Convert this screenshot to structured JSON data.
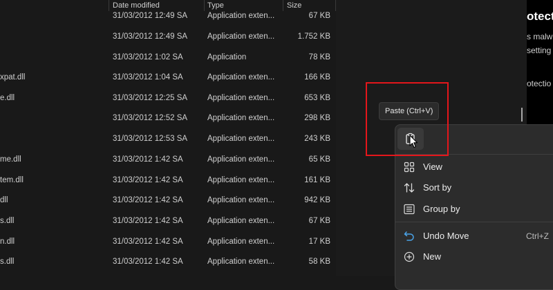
{
  "columns": {
    "date": "Date modified",
    "type": "Type",
    "size": "Size"
  },
  "files": [
    {
      "name": "",
      "date": "31/03/2012 12:49 SA",
      "type": "Application exten...",
      "size": "67 KB"
    },
    {
      "name": "",
      "date": "31/03/2012 12:49 SA",
      "type": "Application exten...",
      "size": "1.752 KB"
    },
    {
      "name": "",
      "date": "31/03/2012 1:02 SA",
      "type": "Application",
      "size": "78 KB"
    },
    {
      "name": "xpat.dll",
      "date": "31/03/2012 1:04 SA",
      "type": "Application exten...",
      "size": "166 KB"
    },
    {
      "name": "e.dll",
      "date": "31/03/2012 12:25 SA",
      "type": "Application exten...",
      "size": "653 KB"
    },
    {
      "name": "",
      "date": "31/03/2012 12:52 SA",
      "type": "Application exten...",
      "size": "298 KB"
    },
    {
      "name": "",
      "date": "31/03/2012 12:53 SA",
      "type": "Application exten...",
      "size": "243 KB"
    },
    {
      "name": "me.dll",
      "date": "31/03/2012 1:42 SA",
      "type": "Application exten...",
      "size": "65 KB"
    },
    {
      "name": "tem.dll",
      "date": "31/03/2012 1:42 SA",
      "type": "Application exten...",
      "size": "161 KB"
    },
    {
      "name": "dll",
      "date": "31/03/2012 1:42 SA",
      "type": "Application exten...",
      "size": "942 KB"
    },
    {
      "name": "s.dll",
      "date": "31/03/2012 1:42 SA",
      "type": "Application exten...",
      "size": "67 KB"
    },
    {
      "name": "n.dll",
      "date": "31/03/2012 1:42 SA",
      "type": "Application exten...",
      "size": "17 KB"
    },
    {
      "name": "s.dll",
      "date": "31/03/2012 1:42 SA",
      "type": "Application exten...",
      "size": "58 KB"
    }
  ],
  "right_pane": {
    "title": "otect",
    "line1": "s malw",
    "line2": "setting",
    "line3": "otectio"
  },
  "tooltip": {
    "text": "Paste (Ctrl+V)"
  },
  "menu": {
    "paste_icon": "paste-icon",
    "items": [
      {
        "label": "View",
        "icon": "grid-icon",
        "shortcut": ""
      },
      {
        "label": "Sort by",
        "icon": "sort-icon",
        "shortcut": ""
      },
      {
        "label": "Group by",
        "icon": "list-icon",
        "shortcut": ""
      },
      {
        "label": "Undo Move",
        "icon": "undo-icon",
        "shortcut": "Ctrl+Z"
      },
      {
        "label": "New",
        "icon": "plus-circle-icon",
        "shortcut": ""
      }
    ]
  },
  "colors": {
    "highlight": "#e5161b",
    "undo_icon": "#4aa3e8",
    "background": "#191919"
  }
}
